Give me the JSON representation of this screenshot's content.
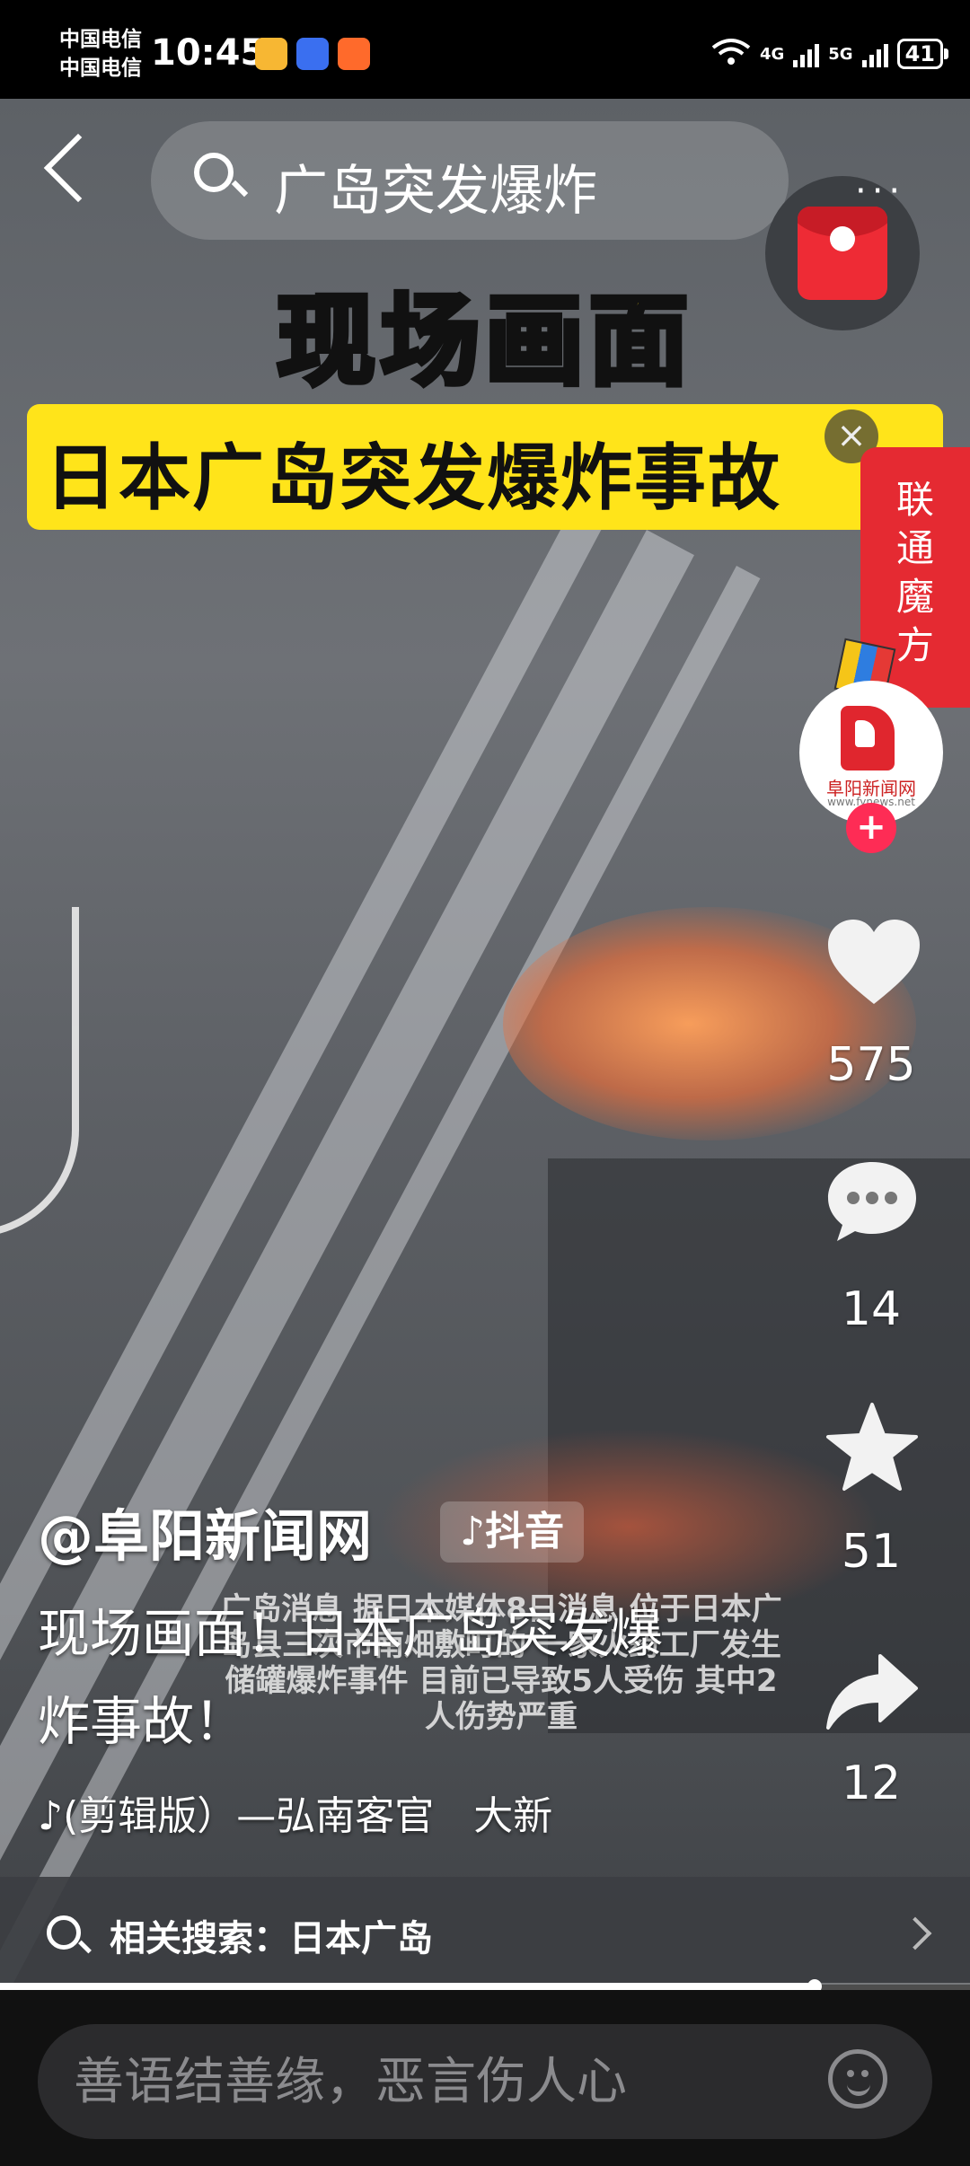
{
  "status_bar": {
    "carrier1": "中国电信",
    "carrier2": "中国电信",
    "time": "10:45",
    "network1": "4G",
    "network2": "5G",
    "battery": "41",
    "app_icons": [
      "weibo-icon",
      "baidu-icon",
      "taobao-icon"
    ]
  },
  "header": {
    "search_query": "广岛突发爆炸",
    "more_label": "···"
  },
  "video": {
    "title_big": "现场画面",
    "title_sub": "日本广岛突发爆炸事故",
    "caption": "广岛消息 据日本媒体8日消息 位于日本广岛县三次市南畑敷町的 一家火药工厂发生储罐爆炸事件 目前已导致5人受伤 其中2人伤势严重"
  },
  "ad": {
    "label": "联通魔方",
    "close": "×"
  },
  "creator": {
    "avatar_name": "阜阳新闻网",
    "avatar_url": "www.fynews.net",
    "follow": "+"
  },
  "actions": {
    "likes": "575",
    "comments": "14",
    "favorites": "51",
    "shares": "12"
  },
  "info": {
    "author": "@阜阳新闻网",
    "platform": "♪抖音",
    "description": "现场画面！日本广岛突发爆炸事故！",
    "music": "♪(剪辑版）—弘南客官　大新"
  },
  "related_search": {
    "label": "相关搜索：日本广岛"
  },
  "progress": {
    "fraction": 0.84
  },
  "comment_bar": {
    "placeholder": "善语结善缘，恶言伤人心"
  },
  "colors": {
    "title_yellow": "#ffe01b",
    "ad_red": "#e52a32",
    "follow_pink": "#fe2c55"
  }
}
